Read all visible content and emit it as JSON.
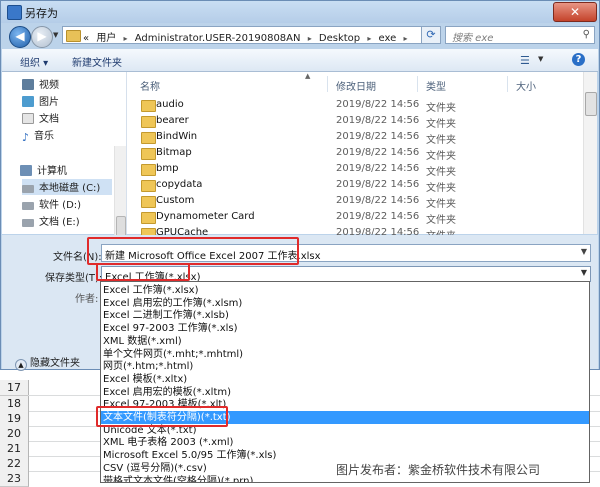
{
  "window": {
    "title": "另存为",
    "close_glyph": "✕"
  },
  "address": {
    "segments": [
      "«",
      "用户",
      "Administrator.USER-20190808AN",
      "Desktop",
      "exe"
    ],
    "separator": "▸",
    "search_placeholder": "搜索 exe"
  },
  "toolbar": {
    "organize": "组织 ▾",
    "new_folder": "新建文件夹"
  },
  "nav_pane": {
    "items": [
      "视频",
      "图片",
      "文档",
      "音乐",
      "计算机",
      "本地磁盘 (C:)",
      "软件 (D:)",
      "文档 (E:)"
    ]
  },
  "file_list": {
    "columns": {
      "name": "名称",
      "date": "修改日期",
      "type": "类型",
      "size": "大小"
    },
    "rows": [
      {
        "name": "audio",
        "date": "2019/8/22 14:56",
        "type": "文件夹"
      },
      {
        "name": "bearer",
        "date": "2019/8/22 14:56",
        "type": "文件夹"
      },
      {
        "name": "BindWin",
        "date": "2019/8/22 14:56",
        "type": "文件夹"
      },
      {
        "name": "Bitmap",
        "date": "2019/8/22 14:56",
        "type": "文件夹"
      },
      {
        "name": "bmp",
        "date": "2019/8/22 14:56",
        "type": "文件夹"
      },
      {
        "name": "copydata",
        "date": "2019/8/22 14:56",
        "type": "文件夹"
      },
      {
        "name": "Custom",
        "date": "2019/8/22 14:56",
        "type": "文件夹"
      },
      {
        "name": "Dynamometer Card",
        "date": "2019/8/22 14:56",
        "type": "文件夹"
      },
      {
        "name": "GPUCache",
        "date": "2019/8/22 14:56",
        "type": "文件夹"
      }
    ]
  },
  "form": {
    "filename_label": "文件名(N):",
    "filename_value": "新建 Microsoft Office Excel 2007 工作表.xlsx",
    "filetype_label": "保存类型(T):",
    "filetype_value": "Excel 工作簿(*.xlsx)",
    "authors_label": "作者:",
    "hide_folders": "隐藏文件夹"
  },
  "file_types": [
    "Excel 工作簿(*.xlsx)",
    "Excel 启用宏的工作簿(*.xlsm)",
    "Excel 二进制工作簿(*.xlsb)",
    "Excel 97-2003 工作簿(*.xls)",
    "XML 数据(*.xml)",
    "单个文件网页(*.mht;*.mhtml)",
    "网页(*.htm;*.html)",
    "Excel 模板(*.xltx)",
    "Excel 启用宏的模板(*.xltm)",
    "Excel 97-2003 模板(*.xlt)",
    "文本文件(制表符分隔)(*.txt)",
    "Unicode 文本(*.txt)",
    "XML 电子表格 2003 (*.xml)",
    "Microsoft Excel 5.0/95 工作簿(*.xls)",
    "CSV (逗号分隔)(*.csv)",
    "带格式文本文件(空格分隔)(*.prn)"
  ],
  "selected_file_type_index": 10,
  "excel_rows": [
    "17",
    "18",
    "19",
    "20",
    "21",
    "22",
    "23"
  ],
  "watermark": "图片发布者：紫金桥软件技术有限公司"
}
